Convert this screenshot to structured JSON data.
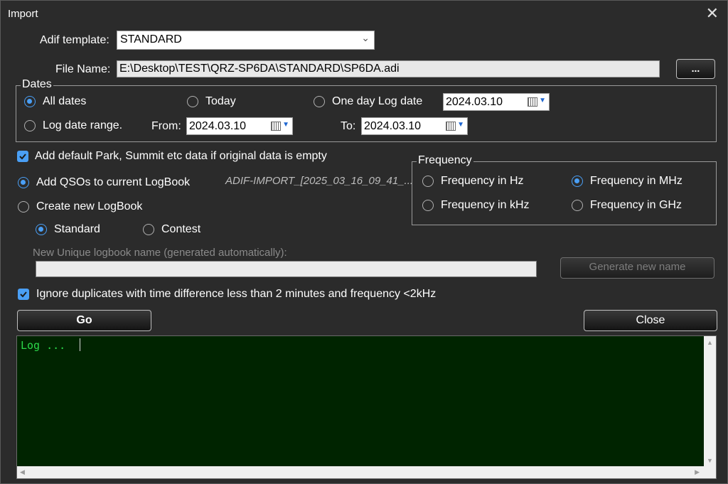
{
  "window": {
    "title": "Import"
  },
  "adif": {
    "label": "Adif template:",
    "value": "STANDARD"
  },
  "file": {
    "label": "File Name:",
    "value": "E:\\Desktop\\TEST\\QRZ-SP6DA\\STANDARD\\SP6DA.adi",
    "browse_label": "..."
  },
  "dates": {
    "legend": "Dates",
    "all_dates": "All dates",
    "today": "Today",
    "one_day": "One day Log date",
    "one_day_value": "2024.03.10",
    "range": "Log date range.",
    "from_label": "From:",
    "from_value": "2024.03.10",
    "to_label": "To:",
    "to_value": "2024.03.10",
    "selected": "all_dates"
  },
  "options": {
    "add_default": "Add default Park, Summit etc data if original data is empty",
    "add_current": "Add QSOs to current LogBook",
    "logbook_name": "ADIF-IMPORT_[2025_03_16_09_41_...",
    "create_new": "Create new LogBook",
    "standard": "Standard",
    "contest": "Contest",
    "unique_label": "New Unique logbook name (generated automatically):",
    "unique_value": "",
    "generate_label": "Generate new name",
    "ignore_dups": "Ignore duplicates with time difference less than 2 minutes and frequency <2kHz"
  },
  "frequency": {
    "legend": "Frequency",
    "hz": "Frequency in Hz",
    "mhz": "Frequency in MHz",
    "khz": "Frequency in kHz",
    "ghz": "Frequency in GHz",
    "selected": "mhz"
  },
  "actions": {
    "go": "Go",
    "close": "Close"
  },
  "log": {
    "text": "Log ..."
  },
  "colors": {
    "accent": "#4a9ff5",
    "log_bg": "#002400",
    "log_text": "#2cd84a",
    "window_bg": "#2b2b2b"
  }
}
